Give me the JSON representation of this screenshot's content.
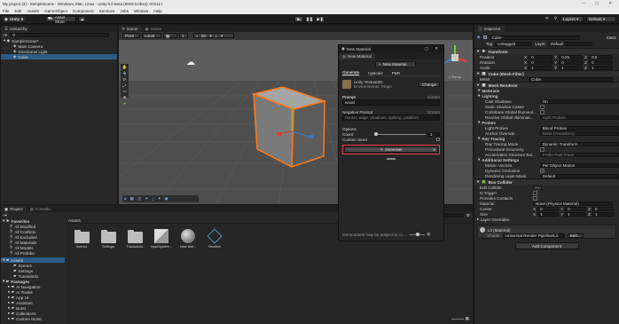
{
  "window": {
    "title": "My project (3) - SampleScene - Windows, Mac, Linux - Unity 6.0 Beta (6000.0.0b13) <DX11>",
    "controls": "—  ▢  ✕"
  },
  "menubar": [
    "File",
    "Edit",
    "Assets",
    "GameObject",
    "Component",
    "Services",
    "Jobs",
    "Window",
    "Help"
  ],
  "toolbar": {
    "account": "Unity 6",
    "asset_store": "Asset Store",
    "play_icon": "play-icon",
    "pause_icon": "pause-icon",
    "step_icon": "step-icon",
    "search_icon": "search-icon",
    "layers": "Layers",
    "layout": "Default"
  },
  "hierarchy": {
    "tab": "Hierarchy",
    "items": [
      "SampleScene*",
      "Main Camera",
      "Directional Light",
      "Cube"
    ]
  },
  "scene": {
    "tabs": [
      "Scene",
      "Game"
    ],
    "pivot": "Pivot",
    "local": "Local",
    "two_d": "2D",
    "persp": "< Persp"
  },
  "overlay": {
    "window_title": "New Material",
    "tab": "New Material",
    "new_material_button": "New Material",
    "sub_tabs": [
      "Generate",
      "Upscale",
      "PBR"
    ],
    "model_name": "Unity Texture2D",
    "model_desc": "Environments, Props",
    "change_button": "Change",
    "prompt_label": "Prompt",
    "prompt_count": "6/1024",
    "prompt_value": "wood",
    "neg_label": "Negative Prompt",
    "neg_count": "0/1024",
    "neg_placeholder": "border, edge, shadows, lighting, gradient",
    "options_label": "Options",
    "count_label": "Count",
    "count_value": "1",
    "custom_seed_label": "Custom Seed",
    "generate_button": "Generate",
    "generate_count": "5",
    "footer_note": "Generations may be subject to co..."
  },
  "project": {
    "tabs": [
      "Project",
      "Console"
    ],
    "favorites_label": "Favorites",
    "favorites": [
      "All Modified",
      "All Conflicts",
      "All Excluded",
      "All Materials",
      "All Models",
      "All Prefabs"
    ],
    "assets_label": "Assets",
    "assets_tree": [
      "Scenes",
      "Settings",
      "TutorialInfo"
    ],
    "packages_label": "Packages",
    "packages": [
      "AI Navigation",
      "AI Toolkit",
      "App UI",
      "Assistant",
      "Burst",
      "Collections",
      "Custom NUnit"
    ],
    "breadcrumb": "Assets",
    "files": [
      {
        "name": "Scenes",
        "type": "folder"
      },
      {
        "name": "Settings",
        "type": "folder"
      },
      {
        "name": "TutorialInfo",
        "type": "folder"
      },
      {
        "name": "InputSystem...",
        "type": "asset"
      },
      {
        "name": "New Mat...",
        "type": "material"
      },
      {
        "name": "Readme",
        "type": "readme"
      }
    ]
  },
  "inspector": {
    "tab": "Inspector",
    "object_name": "Cube",
    "static_label": "Static",
    "tag_label": "Tag",
    "tag_value": "Untagged",
    "layer_label": "Layer",
    "layer_value": "Default",
    "transform": {
      "title": "Transform",
      "rows": [
        {
          "label": "Position",
          "x": "0",
          "y": "0.25",
          "z": "0.5"
        },
        {
          "label": "Rotation",
          "x": "0",
          "y": "0",
          "z": "0"
        },
        {
          "label": "Scale",
          "x": "1",
          "y": "1",
          "z": "1"
        }
      ]
    },
    "mesh_filter": {
      "title": "Cube (Mesh Filter)",
      "mesh_label": "Mesh",
      "mesh_value": "Cube"
    },
    "mesh_renderer": {
      "title": "Mesh Renderer",
      "rows": [
        {
          "label": "Materials",
          "value": "",
          "kind": "fold"
        },
        {
          "label": "Lighting",
          "value": "",
          "kind": "fold"
        },
        {
          "label": "Cast Shadows",
          "value": "On",
          "kind": "field"
        },
        {
          "label": "Static Shadow Caster",
          "value": "",
          "kind": "check"
        },
        {
          "label": "Contribute Global Illuminat...",
          "value": "",
          "kind": "check"
        },
        {
          "label": "Receive Global Illuminati...",
          "value": "Light Probes",
          "kind": "field"
        },
        {
          "label": "Probes",
          "value": "",
          "kind": "fold"
        },
        {
          "label": "Light Probes",
          "value": "Blend Probes",
          "kind": "field"
        },
        {
          "label": "Anchor Override",
          "value": "None (Transform)",
          "kind": "field"
        },
        {
          "label": "Ray Tracing",
          "value": "",
          "kind": "fold"
        },
        {
          "label": "Ray Tracing Mode",
          "value": "Dynamic Transform",
          "kind": "field"
        },
        {
          "label": "Procedural Geometry",
          "value": "",
          "kind": "check"
        },
        {
          "label": "Acceleration Structure Bui...",
          "value": "Prefer Fast Trace",
          "kind": "field"
        },
        {
          "label": "Additional Settings",
          "value": "",
          "kind": "fold"
        },
        {
          "label": "Motion Vectors",
          "value": "Per Object Motion",
          "kind": "field"
        },
        {
          "label": "Dynamic Occlusion",
          "value": "✓",
          "kind": "check"
        },
        {
          "label": "Rendering Layer Mask",
          "value": "Default",
          "kind": "field"
        }
      ]
    },
    "box_collider": {
      "title": "Box Collider",
      "rows": [
        {
          "label": "Edit Collider",
          "value": ""
        },
        {
          "label": "Is Trigger",
          "value": ""
        },
        {
          "label": "Provides Contacts",
          "value": ""
        },
        {
          "label": "Material",
          "value": "None (Physics Material)"
        },
        {
          "label": "Center",
          "x": "0",
          "y": "0",
          "z": "0"
        },
        {
          "label": "Size",
          "x": "1",
          "y": "1",
          "z": "1"
        }
      ],
      "layer_overrides": "Layer Overrides"
    },
    "material": {
      "name": "Lit (Material)",
      "shader_label": "Shader",
      "shader_value": "Universal Render Pipeline/Lit",
      "edit_button": "Edit..."
    },
    "add_component": "Add Component"
  },
  "colors": {
    "accent": "#3d78c8",
    "selection": "#2c5d87",
    "outline": "#ff7a1a",
    "generate_border": "#e8424a"
  }
}
